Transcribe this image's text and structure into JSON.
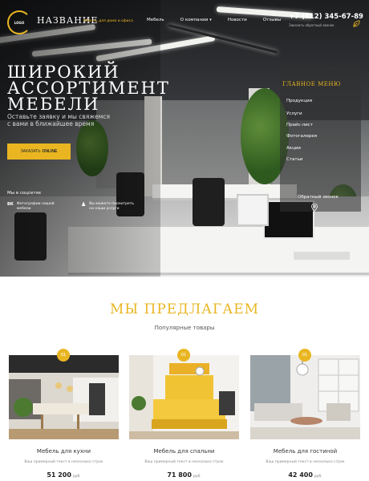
{
  "header": {
    "logo_line1": "LOGO",
    "logo_line2": "",
    "brand": "НАЗВАНИЕ",
    "tagline": "Мебель для дома и офиса",
    "nav": [
      {
        "label": "Мебель",
        "has_dropdown": false
      },
      {
        "label": "О компании",
        "has_dropdown": true
      },
      {
        "label": "Новости",
        "has_dropdown": false
      },
      {
        "label": "Отзывы",
        "has_dropdown": false
      }
    ],
    "phone": "+7 (012) 345-67-89",
    "phone_sub": "Заказать обратный звонок"
  },
  "hero": {
    "title_lines": [
      "ШИРОКИЙ",
      "АССОРТИМЕНТ",
      "МЕБЕЛИ"
    ],
    "subtitle_lines": [
      "Оставьте заявку и мы свяжемся",
      "с вами в ближайшее время"
    ],
    "cta_label": "ЗАКАЗАТЬ",
    "cta_strong": "ONLINE",
    "social_label": "Мы в соцсетях",
    "features": [
      {
        "icon": "vk-icon",
        "glyph": "ВК",
        "text": "Фотографии нашей мебели"
      },
      {
        "icon": "person-icon",
        "glyph": "♟",
        "text": "Вы можете посмотреть на наши услуги"
      }
    ]
  },
  "main_menu": {
    "title": "ГЛАВНОЕ МЕНЮ",
    "items": [
      "Продукция",
      "Услуги",
      "Прайс-лист",
      "Фотогалерея",
      "Акции",
      "Статьи"
    ],
    "callback": "Обратный звонок"
  },
  "section": {
    "title": "МЫ ПРЕДЛАГАЕМ",
    "subtitle": "Популярные товары"
  },
  "products": [
    {
      "badge": "01",
      "name": "Мебель для кухни",
      "desc": "Ваш примерный текст в несколько строк",
      "price": "51 200",
      "currency": "руб."
    },
    {
      "badge": "01",
      "name": "Мебель для спальни",
      "desc": "Ваш примерный текст в несколько строк",
      "price": "71 800",
      "currency": "руб."
    },
    {
      "badge": "01",
      "name": "Мебель для гостиной",
      "desc": "Ваш примерный текст в несколько строк",
      "price": "42 400",
      "currency": "руб."
    }
  ],
  "colors": {
    "accent": "#e9b622",
    "text": "#222222",
    "muted": "#888888"
  }
}
